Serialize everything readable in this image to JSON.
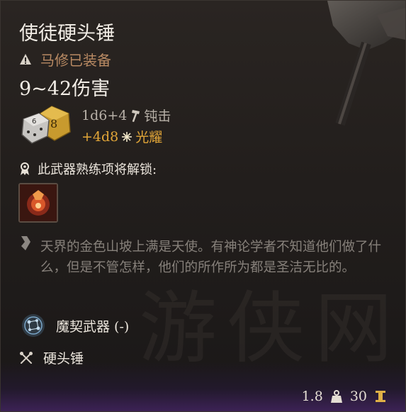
{
  "item": {
    "name": "使徒硬头锤",
    "equipped_by": "马修已装备",
    "damage_total": "9~42伤害",
    "damage_lines": [
      {
        "dice": "1d6+4",
        "type": "钝击"
      },
      {
        "dice": "+4d8",
        "type": "光耀"
      }
    ],
    "proficiency_title": "此武器熟练项将解锁:",
    "lore": "天界的金色山坡上满是天使。有神论学者不知道他们做了什么，但是不管怎样，他们的所作所为都是圣洁无比的。",
    "pact_weapon": "魔契武器 (-)",
    "weapon_type": "硬头锤",
    "weight": "1.8",
    "value": "30"
  },
  "watermark": "游侠网",
  "colors": {
    "title": "#f2ede6",
    "equipped": "#b98a63",
    "radiant": "#e2a638",
    "lore": "#86807a"
  },
  "icons": {
    "warning": "warning-icon",
    "dice": "dice-icon",
    "bludgeon": "hammer-icon",
    "radiant": "radiant-icon",
    "proficiency": "proficiency-icon",
    "skill": "skill-icon",
    "lore": "lore-icon",
    "pact": "pact-weapon-icon",
    "weapon_type": "crossed-maces-icon",
    "weight": "weight-icon",
    "gold": "gold-icon"
  }
}
